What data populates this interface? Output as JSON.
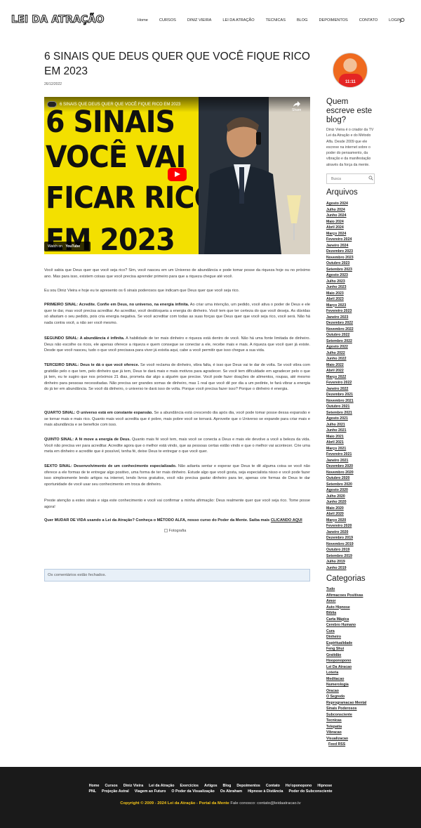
{
  "header": {
    "logo": "LEI DA ATRAÇÃO",
    "nav": [
      "Home",
      "CURSOS",
      "DINIZ VIEIRA",
      "LEI DA ATRAÇÃO",
      "TECNICAS",
      "BLOG",
      "DEPOIMENTOS",
      "CONTATO",
      "LOGIN"
    ],
    "search_icon": "search-icon"
  },
  "post": {
    "title": "6 SINAIS QUE DEUS QUER QUE VOCÊ FIQUE RICO EM 2023",
    "date": "26/12/2022"
  },
  "video": {
    "title": "6 SINAIS QUE DEUS QUER QUE VOCÊ FIQUE RICO EM 2023",
    "big_lines": [
      "6 SINAIS",
      "VOCÊ VAI",
      "FICAR RICO",
      "EM 2023"
    ],
    "share": "Share",
    "watch_on": "Watch on",
    "youtube": "YouTube"
  },
  "content": {
    "p1": "Você sabia que Deus quer que você seja rico? Sim, você nasceu em um Universo de abundância e pode tomar posse da riqueza hoje ou no próximo ano. Mas para isso, existem coisas que você precisa aprender primeiro para que a riqueza chegue até você.",
    "p2": "Eu sou Diniz Vieira e hoje eu te apresento os 6 sinais poderosos que indicam que Deus quer que você seja rico.",
    "s1_label": "PRIMEIRO SINAL: Acredite. Confie em Deus, no universo, na energia infinita.",
    "s1_text": " Ao criar uma intenção, um pedido, você ativa o poder de Deus e ele quer te dar, mas você precisa acreditar. Ao acreditar, você desbloqueia a energia do dinheiro. Você tem que ter certeza do que você deseja. As dúvidas só afastam o seu pedido, pois cria energia negativa. Se você acreditar com todas as suas forças que Deus quer que você seja rico, você será. Não há nada contra você, a não ser você mesmo.",
    "s2_label": "SEGUNDO SINAL: A abundância é infinita.",
    "s2_text": " A habilidade de ter mais dinheiro e riqueza está dentro de você. Não há uma fonte limitada de dinheiro. Deus não escolhe os ricos, ele apenas oferece a riqueza e quem consegue se conectar a ele, recebe mais e mais. A riqueza que você quer já existe.  Desde que você nasceu, tudo o que você precisava para viver já existia aqui, cabe a você permitir que isso chegue a sua vida.",
    "s3_label": "TERCEIRO SINAL: Deus te dá o que você oferece.",
    "s3_text": " Se você reclama de dinheiro, vibra falta, é isso que Deus vai te dar de volta. Se você vibra com gratidão pelo o que tem, pelo dinheiro que já tem, Deus te dará mais e mais motivos para agradecer. Se você tem dificuldade em agradecer pelo o que já tem, eu te sugiro que nos próximos 21 dias, prometa dar algo a alguém que precise. Você pode fazer doações de alimentos, roupas, até mesmo dinheiro para pessoas necessitadas. Não precisa ser grandes somas de dinheiro, mas 1 real que você dê por dia a um pedinte, te fará vibrar a energia do já ter em abundância. Se você dá dinheiro, o universo te dará isso de volta. Porque você precisa fazer isso? Porque o dinheiro é energia.",
    "s4_label": "QUARTO SINAL: O universo está em constante expansão.",
    "s4_text": " Se a abundância está crescendo dia após dia, você pode tomar posse dessa expansão e se tornar mais e mais rico.   Quanto mais você acredita que é pobre, mais pobre você se tornará. Aproveite que o Universo se expande para criar mais e mais abundância e se beneficie com isso.",
    "s5_label": "QUINTO SINAL: A fé move a energia de Deus.",
    "s5_text": " Quanto mais fé você tem, mais você se conecta a Deus e mais ele devolve a você a beleza da vida. Você não precisa ver para acreditar. Acredite agora que o melhor está vindo, que as pessoas certas estão vindo e que o melhor vai acontecer. Crie uma meta em dinheiro e acredite que é possível, tenha fé, deixe Deus te entregar o que você quer.",
    "s6_label": "SEXTO SINAL: Desenvolvimento de um conhecimento especializado.",
    "s6_text": " Não adianta sentar e esperar que Deus te dê alguma coisa se você não oferece a ele formas de te entregar algo positivo, uma forma de ter mais dinheiro. Estude algo que você gosta, seja especialista nisso e você pode fazer isso simplesmente lendo artigos na internet, lendo livros gratuitos, você não precisa gastar dinheiro para ter, apenas crie formas de Deus te dar oportunidade de você usar seu conhecimento em troca de dinheiro.",
    "closing": "Preste atenção a estes sinais e siga este conhecimento e você vai confirmar a minha afirmação: Deus realmente quer que você seja rico. Tome posse agora!",
    "cta_text": "Quer MUDAR DE VIDA usando a Lei da Atração? Conheça o MÉTODO ALFA, nosso curso do Poder da Mente. Saiba mais ",
    "cta_link": "CLICANDO AQUI",
    "photo_alt": "Fotografia",
    "comments_closed": "Os comentários estão fechados."
  },
  "sidebar": {
    "author_heading": "Quem escreve este blog?",
    "avatar_text": "11:11",
    "bio": "Diniz Vieira é o criador da TV Lei da Atração e do Método Alfa. Desde 2009 que ele escreve na internet sobre o poder do pensamento, da vibração e da manifestação através da força da mente.",
    "search_placeholder": "Busca",
    "archives_heading": "Arquivos",
    "archives": [
      "Agosto 2024",
      "Julho 2024",
      "Junho 2024",
      "Maio 2024",
      "Abril 2024",
      "Março 2024",
      "Fevereiro 2024",
      "Janeiro 2024",
      "Dezembro 2023",
      "Novembro 2023",
      "Outubro 2023",
      "Setembro 2023",
      "Agosto 2023",
      "Julho 2023",
      "Junho 2023",
      "Maio 2023",
      "Abril 2023",
      "Março 2023",
      "Fevereiro 2023",
      "Janeiro 2023",
      "Dezembro 2022",
      "Novembro 2022",
      "Outubro 2022",
      "Setembro 2022",
      "Agosto 2022",
      "Julho 2022",
      "Junho 2022",
      "Maio 2022",
      "Abril 2022",
      "Março 2022",
      "Fevereiro 2022",
      "Janeiro 2022",
      "Dezembro 2021",
      "Novembro 2021",
      "Outubro 2021",
      "Setembro 2021",
      "Agosto 2021",
      "Julho 2021",
      "Junho 2021",
      "Maio 2021",
      "Abril 2021",
      "Março 2021",
      "Fevereiro 2021",
      "Janeiro 2021",
      "Dezembro 2020",
      "Novembro 2020",
      "Outubro 2020",
      "Setembro 2020",
      "Agosto 2020",
      "Julho 2020",
      "Junho 2020",
      "Maio 2020",
      "Abril 2020",
      "Março 2020",
      "Fevereiro 2020",
      "Janeiro 2020",
      "Dezembro 2019",
      "Novembro 2019",
      "Outubro 2019",
      "Setembro 2019",
      "Julho 2019",
      "Junho 2019"
    ],
    "categories_heading": "Categorias",
    "categories": [
      "Tudo",
      "Afirmacoes Positivas",
      "Amor",
      "Auto Hipnose",
      "Bíblia",
      "Carta Mágica",
      "Cerebro Humano",
      "Cura",
      "Dinheiro",
      "Espiritualidade",
      "Feng Shui",
      "Gratidão",
      "Hooponopono",
      "Lei Da Atracao",
      "Loteria",
      "Meditacao",
      "Numerologia",
      "Oracao",
      "O Segredo",
      "Reprogramacao Mental",
      "Sinais Poderosos",
      "Subconsciente",
      "Tecnicas",
      "Telepatia",
      "Vibracao",
      "Visualizacao"
    ],
    "feed": "Feed RSS"
  },
  "footer": {
    "row1": [
      "Home",
      "Cursos",
      "Diniz Vieira",
      "Lei da Atração",
      "Exercícios",
      "Artigos",
      "Blog",
      "Depoimentos",
      "Contato",
      "Ho'oponopono",
      "Hipnose"
    ],
    "row2": [
      "PNL",
      "Projeção Astral",
      "Viagem ao Futuro",
      "O Poder da Visualização",
      "Os Abraham",
      "Hipnose à Distância",
      "Poder do Subconsciente"
    ],
    "copyright": "Copyright © 2009 - 2024 Lei da Atração - Portal da Mente",
    "contact": " Fale conosco: contato@leidaatracao.tv"
  },
  "colors": {
    "accent_yellow": "#f3e000",
    "youtube_red": "#ff0000",
    "footer_bg": "#1a1a1a",
    "copyright_gold": "#f5c518"
  }
}
